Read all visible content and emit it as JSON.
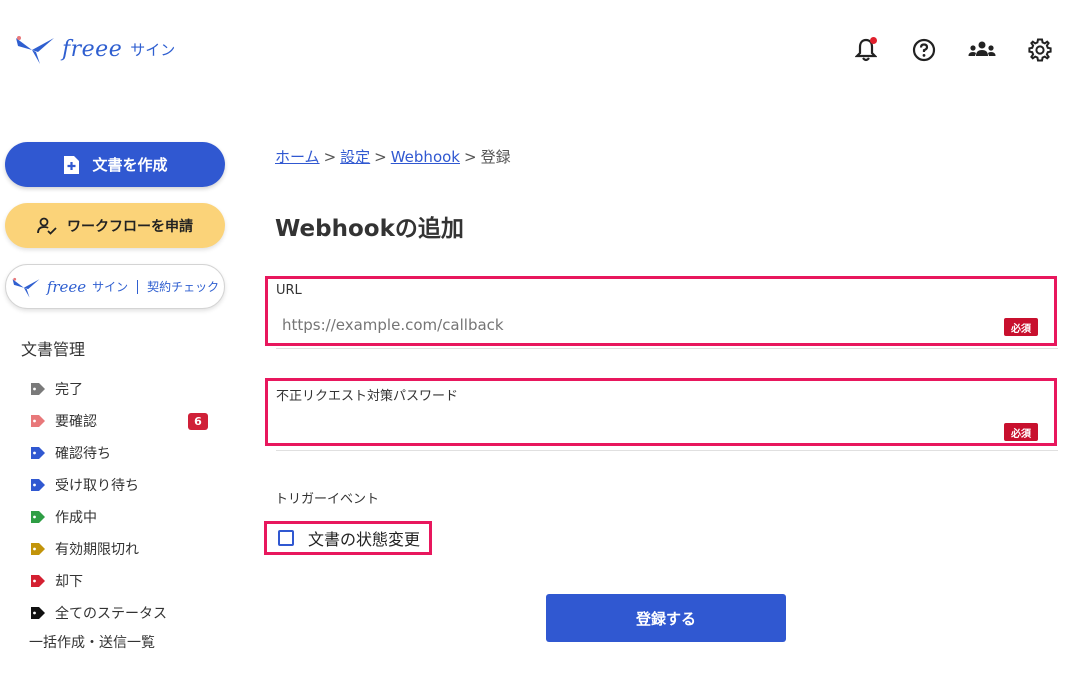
{
  "header": {
    "logo_word": "freee",
    "logo_sign": "サイン",
    "icons": [
      "bell-icon",
      "help-icon",
      "team-icon",
      "gear-icon"
    ],
    "has_notification": true
  },
  "sidebar": {
    "create_button": "文書を作成",
    "workflow_button": "ワークフローを申請",
    "check_button": {
      "word": "freee",
      "sign": "サイン",
      "label": "契約チェック"
    },
    "section_title": "文書管理",
    "items": [
      {
        "label": "完了",
        "color": "#7a7a7a"
      },
      {
        "label": "要確認",
        "color": "#e8787a",
        "badge": "6"
      },
      {
        "label": "確認待ち",
        "color": "#3058d1"
      },
      {
        "label": "受け取り待ち",
        "color": "#3058d1"
      },
      {
        "label": "作成中",
        "color": "#2e9e44"
      },
      {
        "label": "有効期限切れ",
        "color": "#c2940a"
      },
      {
        "label": "却下",
        "color": "#d42031"
      },
      {
        "label": "全てのステータス",
        "color": "#111111"
      }
    ],
    "bulk_link": "一括作成・送信一覧"
  },
  "breadcrumb": {
    "home": "ホーム",
    "settings": "設定",
    "webhook": "Webhook",
    "current": "登録",
    "separator": ">"
  },
  "page_title": "Webhookの追加",
  "form": {
    "url_label": "URL",
    "url_placeholder": "https://example.com/callback",
    "url_value": "",
    "password_label": "不正リクエスト対策パスワード",
    "password_value": "",
    "required_badge": "必須",
    "trigger_label": "トリガーイベント",
    "checkbox_label": "文書の状態変更",
    "checkbox_checked": false,
    "submit": "登録する"
  },
  "colors": {
    "primary": "#3058d1",
    "accent_yellow": "#fbd379",
    "highlight": "#e8175d",
    "required": "#c8102e"
  }
}
